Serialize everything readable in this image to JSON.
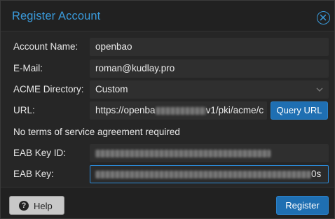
{
  "dialog": {
    "title": "Register Account",
    "close_icon": "close-icon"
  },
  "form": {
    "account_name": {
      "label": "Account Name:",
      "value": "openbao"
    },
    "email": {
      "label": "E-Mail:",
      "value": "roman@kudlay.pro"
    },
    "acme_directory": {
      "label": "ACME Directory:",
      "value": "Custom"
    },
    "url": {
      "label": "URL:",
      "value_prefix": "https://openba",
      "value_suffix": "v1/pki/acme/c"
    },
    "query_url_label": "Query URL",
    "tos_info": "No terms of service agreement required",
    "eab_key_id": {
      "label": "EAB Key ID:"
    },
    "eab_key": {
      "label": "EAB Key:",
      "value_tail": "0s"
    }
  },
  "footer": {
    "help_label": "Help",
    "help_icon": "question-circle-icon",
    "register_label": "Register"
  },
  "colors": {
    "accent": "#3a9bdc",
    "primary_button": "#1f6fb2",
    "background": "#262626",
    "field_background": "#2f2f2f"
  }
}
